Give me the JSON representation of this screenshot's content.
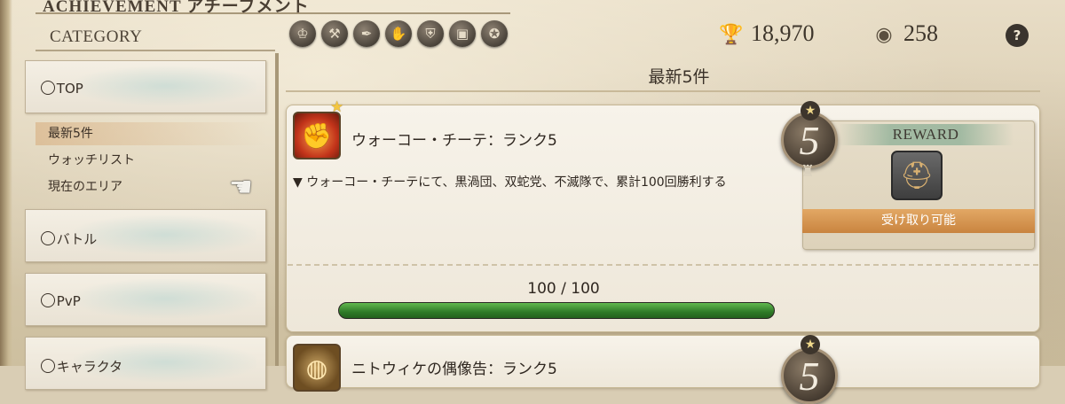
{
  "header": {
    "title": "ACHIEVEMENT アチーブメント",
    "category_label": "CATEGORY",
    "category_icons": [
      "goblet-icon",
      "anvil-icon",
      "feather-icon",
      "hand-icon",
      "armor-icon",
      "chest-icon",
      "medal-icon"
    ],
    "currency": [
      {
        "icon": "trophy-icon",
        "value": "18,970"
      },
      {
        "icon": "coin-icon",
        "value": "258"
      }
    ],
    "help": "?"
  },
  "sidebar": {
    "top": {
      "label": "TOP"
    },
    "sub_items": [
      "最新5件",
      "ウォッチリスト",
      "現在のエリア"
    ],
    "groups": [
      {
        "label": "バトル"
      },
      {
        "label": "PvP"
      },
      {
        "label": "キャラクタ"
      }
    ]
  },
  "main": {
    "title": "最新5件",
    "achievements": [
      {
        "name": "ウォーコー・チーテ：ランク5",
        "description": "▼ ウォーコー・チーテにて、黒渦団、双蛇党、不滅隊で、累計100回勝利する",
        "rank": "5",
        "reward_header": "REWARD",
        "claim_label": "受け取り可能",
        "progress_text": "100 / 100",
        "progress": 1.0
      },
      {
        "name": "ニトウィケの偶像告：ランク5",
        "rank": "5"
      }
    ]
  },
  "colors": {
    "progress_fill": "#3f9a35",
    "claim_bar": "#d39553",
    "reward_header": "#8cae96"
  }
}
